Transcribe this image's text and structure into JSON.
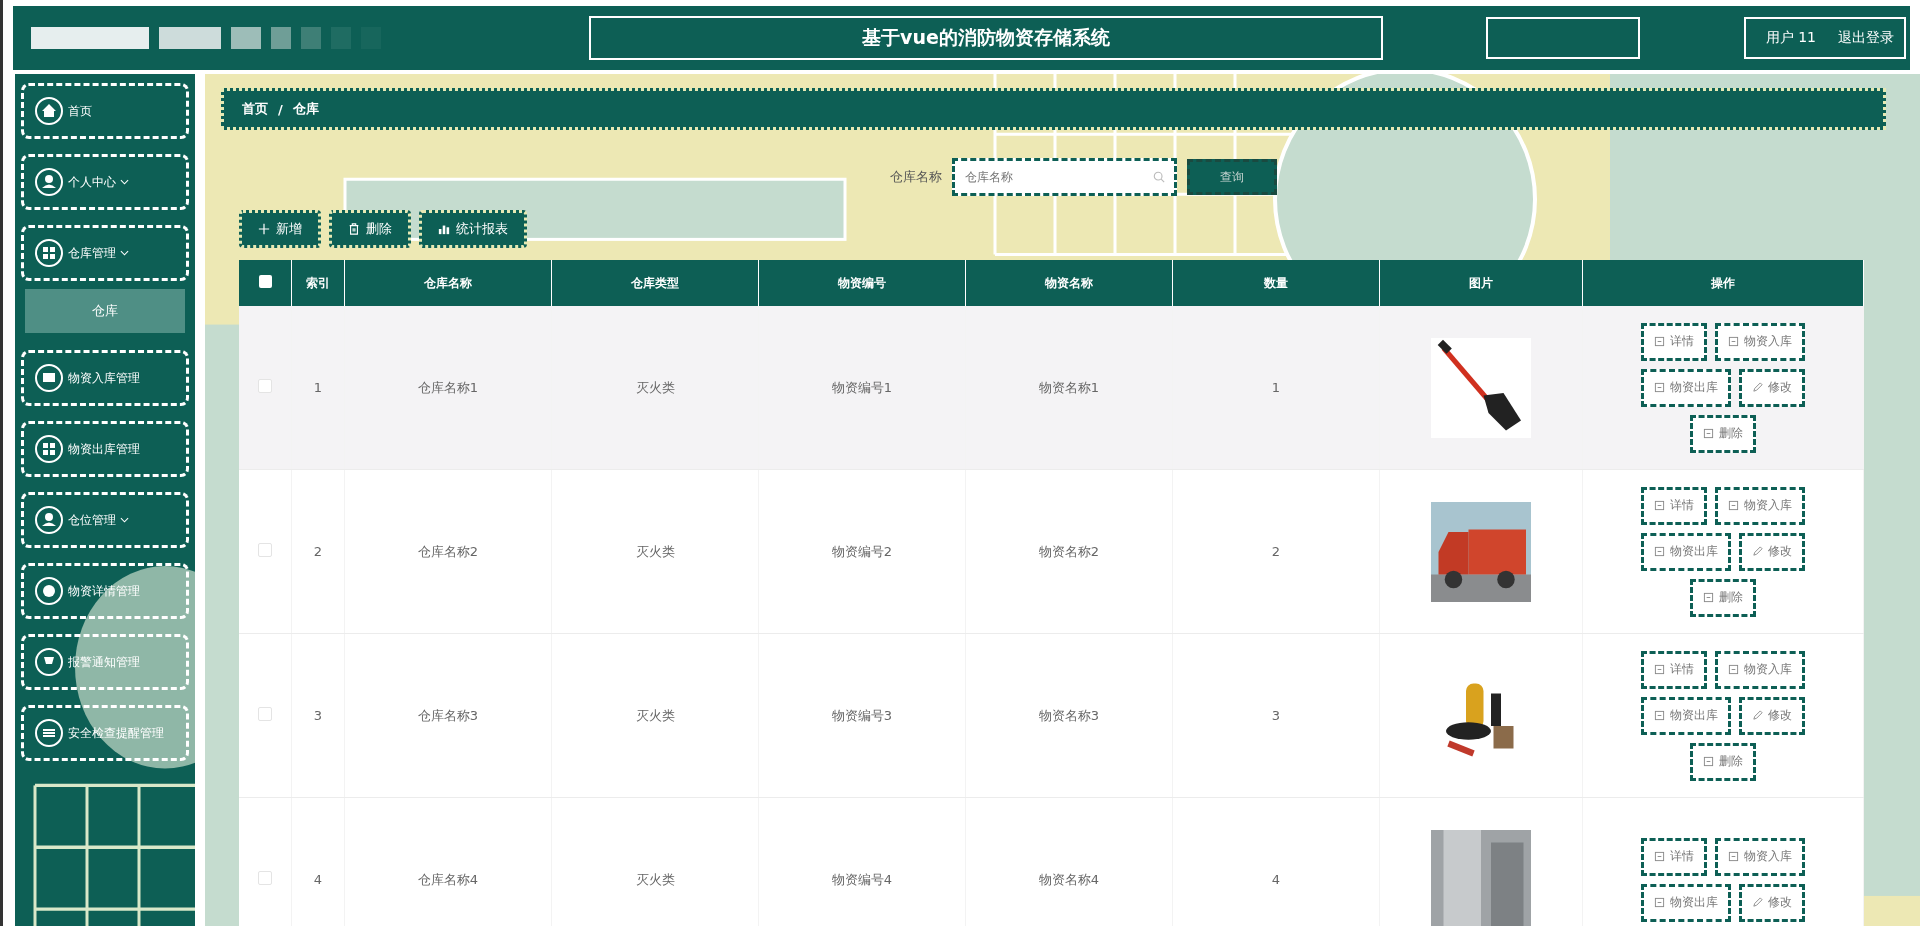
{
  "header": {
    "title": "基于vue的消防物资存储系统",
    "user": "用户 11",
    "logout": "退出登录"
  },
  "sidebar": {
    "items": [
      {
        "label": "首页",
        "expandable": false
      },
      {
        "label": "个人中心",
        "expandable": true
      },
      {
        "label": "仓库管理",
        "expandable": true,
        "children": [
          {
            "label": "仓库",
            "selected": true
          }
        ]
      },
      {
        "label": "物资入库管理",
        "expandable": false
      },
      {
        "label": "物资出库管理",
        "expandable": false
      },
      {
        "label": "仓位管理",
        "expandable": true
      },
      {
        "label": "物资详情管理",
        "expandable": false
      },
      {
        "label": "报警通知管理",
        "expandable": false
      },
      {
        "label": "安全检查提醒管理",
        "expandable": false
      }
    ]
  },
  "breadcrumb": {
    "separator": "/",
    "items": [
      "首页",
      "仓库"
    ]
  },
  "search": {
    "label": "仓库名称",
    "placeholder": "仓库名称",
    "button": "查询"
  },
  "toolbar": [
    "新增",
    "删除",
    "统计报表"
  ],
  "table": {
    "columns": [
      "索引",
      "仓库名称",
      "仓库类型",
      "物资编号",
      "物资名称",
      "数量",
      "图片",
      "操作"
    ],
    "header_checked": false,
    "rows": [
      {
        "checked": false,
        "hovered": true,
        "cells": [
          "1",
          "仓库名称1",
          "灭火类",
          "物资编号1",
          "物资名称1",
          "1"
        ],
        "actions": [
          "详情",
          "物资入库",
          "物资出库",
          "修改",
          "删除"
        ]
      },
      {
        "checked": false,
        "hovered": false,
        "cells": [
          "2",
          "仓库名称2",
          "灭火类",
          "物资编号2",
          "物资名称2",
          "2"
        ],
        "actions": [
          "详情",
          "物资入库",
          "物资出库",
          "修改",
          "删除"
        ]
      },
      {
        "checked": false,
        "hovered": false,
        "cells": [
          "3",
          "仓库名称3",
          "灭火类",
          "物资编号3",
          "物资名称3",
          "3"
        ],
        "actions": [
          "详情",
          "物资入库",
          "物资出库",
          "修改",
          "删除"
        ]
      },
      {
        "checked": false,
        "hovered": false,
        "cells": [
          "4",
          "仓库名称4",
          "灭火类",
          "物资编号4",
          "物资名称4",
          "4"
        ],
        "actions": [
          "详情",
          "物资入库",
          "物资出库",
          "修改"
        ]
      }
    ]
  }
}
